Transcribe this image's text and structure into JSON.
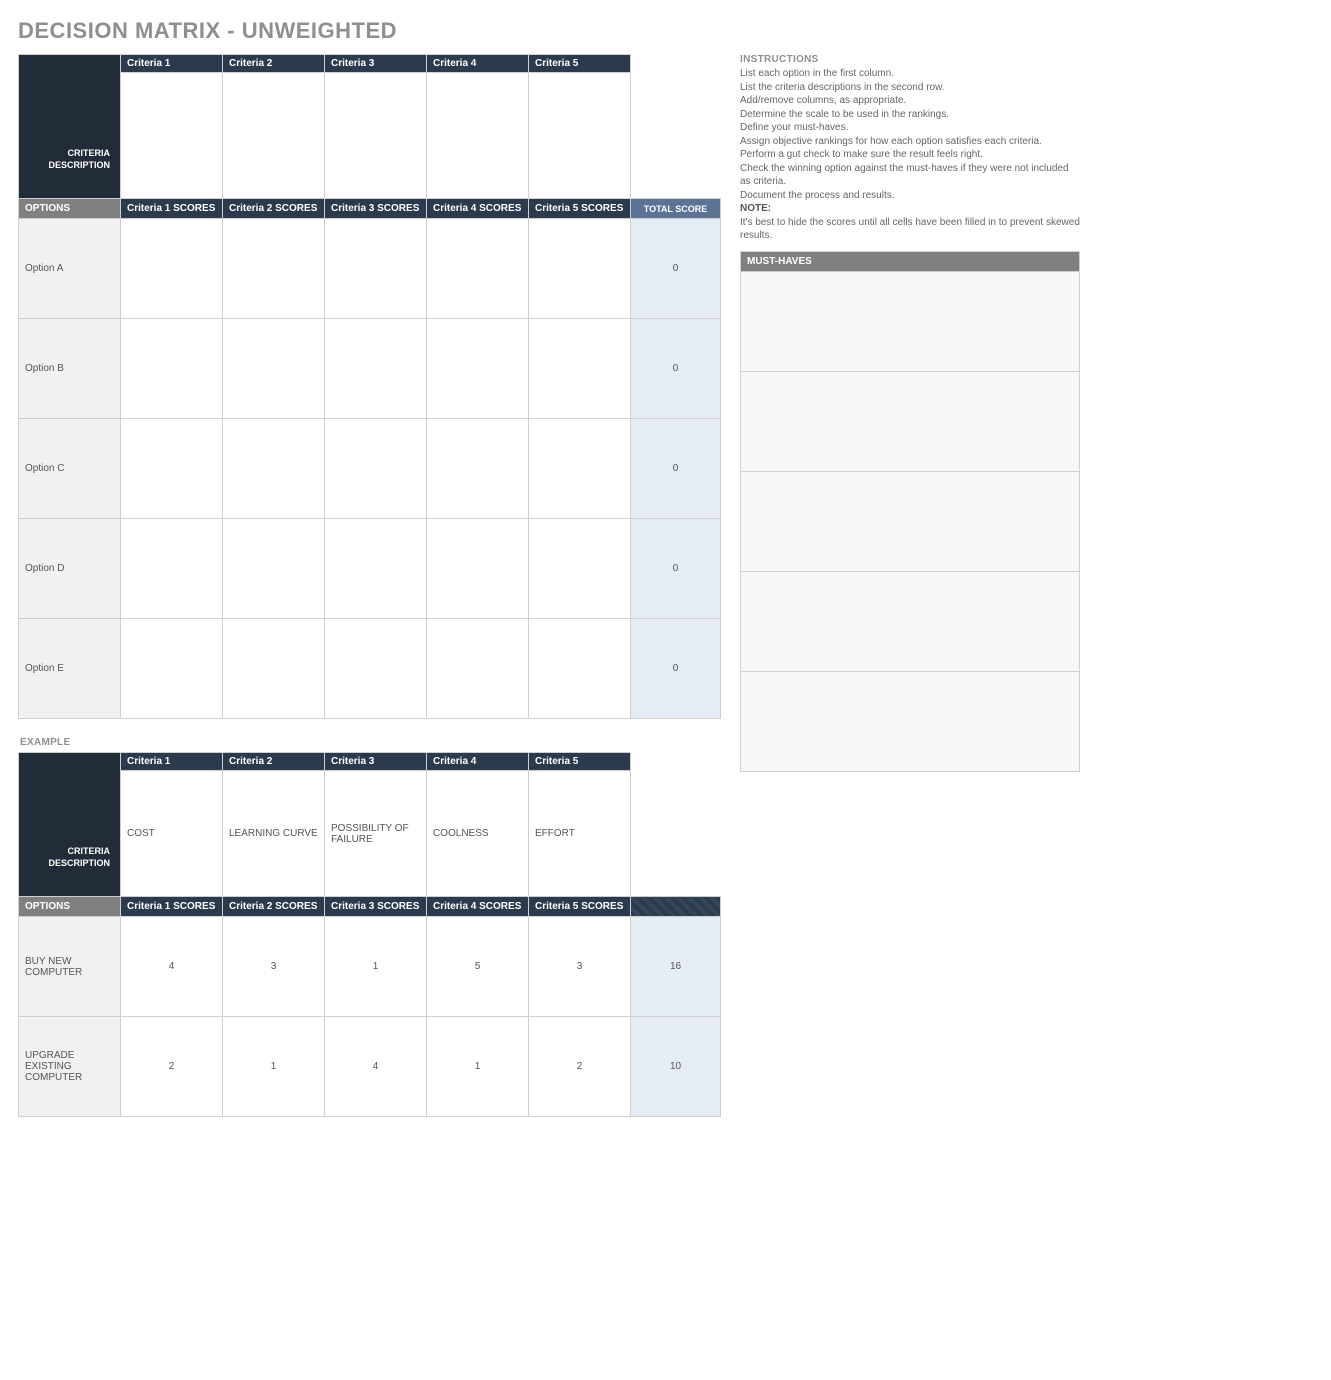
{
  "title": "DECISION MATRIX - UNWEIGHTED",
  "matrix": {
    "criteria_header": [
      "Criteria 1",
      "Criteria 2",
      "Criteria 3",
      "Criteria 4",
      "Criteria 5"
    ],
    "criteria_desc_label": "CRITERIA\nDESCRIPTION",
    "options_label": "OPTIONS",
    "score_headers": [
      "Criteria 1 SCORES",
      "Criteria 2 SCORES",
      "Criteria 3 SCORES",
      "Criteria 4 SCORES",
      "Criteria 5 SCORES"
    ],
    "total_label": "TOTAL SCORE",
    "options": [
      {
        "name": "Option A",
        "total": "0"
      },
      {
        "name": "Option B",
        "total": "0"
      },
      {
        "name": "Option C",
        "total": "0"
      },
      {
        "name": "Option D",
        "total": "0"
      },
      {
        "name": "Option E",
        "total": "0"
      }
    ]
  },
  "instructions": {
    "title": "INSTRUCTIONS",
    "lines": [
      "List each option in the first column.",
      "List the criteria descriptions in the second row.",
      "Add/remove columns, as appropriate.",
      "Determine the scale to be used in the rankings.",
      "Define your must-haves.",
      "Assign objective rankings for how each option satisfies each criteria.",
      "Perform a gut check to make sure the result feels right.",
      "Check the winning option against the must-haves if they were not included as criteria.",
      "Document the process and results."
    ],
    "note_label": "NOTE:",
    "note_text": "It's best to hide the scores until all cells have been filled in to prevent skewed results."
  },
  "must_haves": {
    "title": "MUST-HAVES",
    "rows": 5
  },
  "example": {
    "title": "EXAMPLE",
    "criteria_header": [
      "Criteria 1",
      "Criteria 2",
      "Criteria 3",
      "Criteria 4",
      "Criteria 5"
    ],
    "criteria_desc_label": "CRITERIA\nDESCRIPTION",
    "criteria_desc": [
      "COST",
      "LEARNING CURVE",
      "POSSIBILITY OF FAILURE",
      "COOLNESS",
      "EFFORT"
    ],
    "options_label": "OPTIONS",
    "score_headers": [
      "Criteria 1 SCORES",
      "Criteria 2 SCORES",
      "Criteria 3 SCORES",
      "Criteria 4 SCORES",
      "Criteria 5 SCORES"
    ],
    "options": [
      {
        "name": "BUY NEW COMPUTER",
        "scores": [
          "4",
          "3",
          "1",
          "5",
          "3"
        ],
        "total": "16"
      },
      {
        "name": "UPGRADE EXISTING COMPUTER",
        "scores": [
          "2",
          "1",
          "4",
          "1",
          "2"
        ],
        "total": "10"
      }
    ]
  }
}
